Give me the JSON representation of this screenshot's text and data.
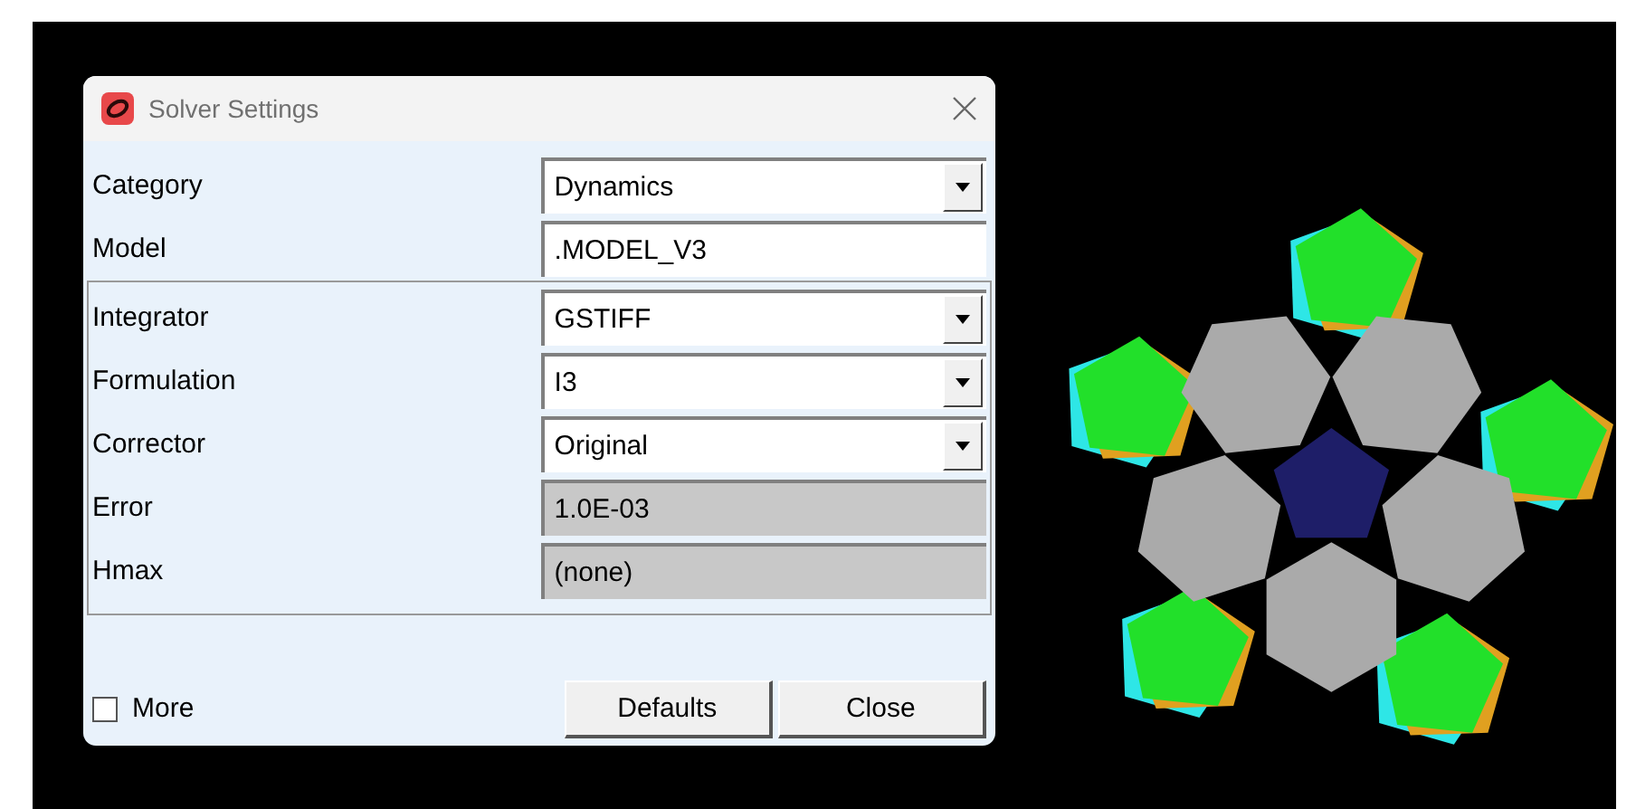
{
  "window": {
    "title": "Solver Settings"
  },
  "fields": [
    {
      "label": "Category",
      "kind": "dropdown",
      "value": "Dynamics"
    },
    {
      "label": "Model",
      "kind": "text",
      "value": ".MODEL_V3"
    }
  ],
  "group_fields": [
    {
      "label": "Integrator",
      "kind": "dropdown",
      "value": "GSTIFF"
    },
    {
      "label": "Formulation",
      "kind": "dropdown",
      "value": "I3"
    },
    {
      "label": "Corrector",
      "kind": "dropdown",
      "value": "Original"
    },
    {
      "label": "Error",
      "kind": "readonly",
      "value": "1.0E-03"
    },
    {
      "label": "Hmax",
      "kind": "readonly",
      "value": "(none)"
    }
  ],
  "more": {
    "label": "More",
    "checked": false
  },
  "buttons": [
    "Defaults",
    "Close"
  ]
}
